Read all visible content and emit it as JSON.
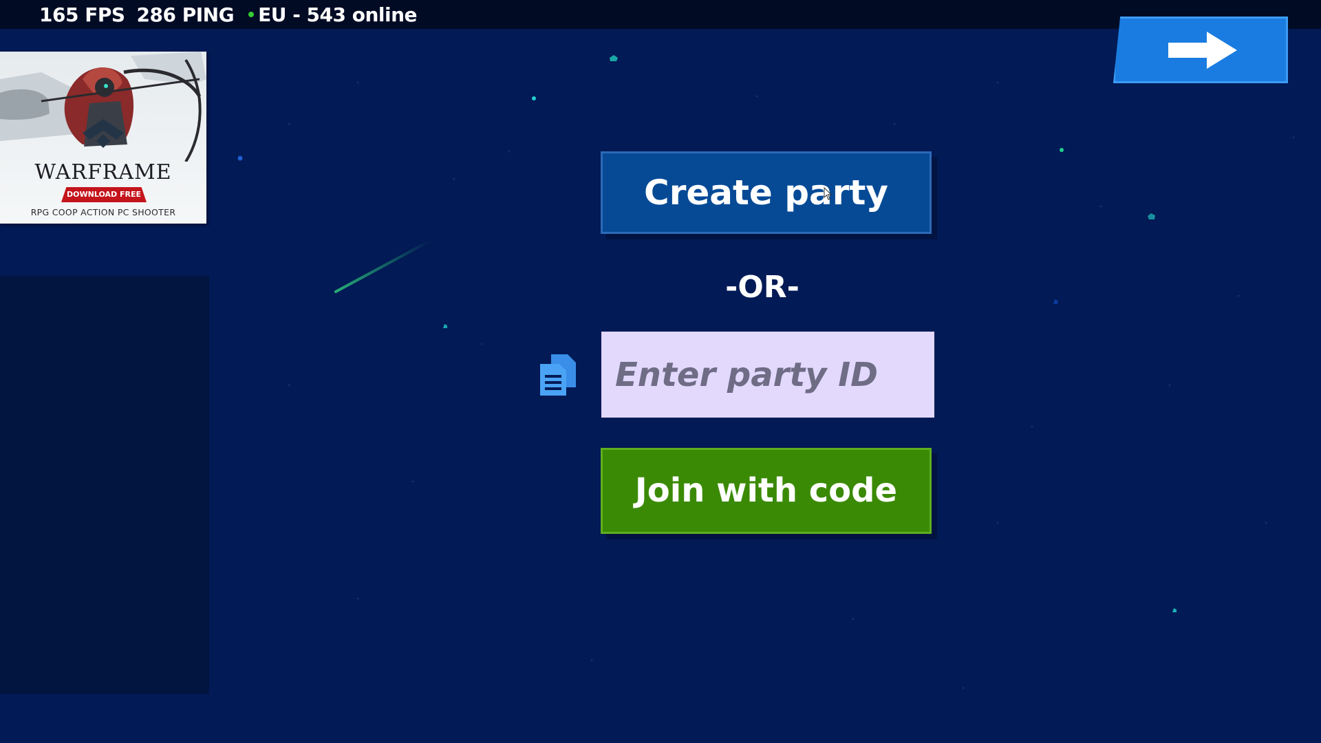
{
  "hud": {
    "fps": "165 FPS",
    "ping": "286 PING",
    "server": "EU - 543 online",
    "online_dot_color": "#33cc33"
  },
  "ad": {
    "brand": "WARFRAME",
    "cta": "DOWNLOAD FREE",
    "tagline": "RPG COOP ACTION PC SHOOTER"
  },
  "nav": {
    "next_icon": "arrow-right-icon"
  },
  "menu": {
    "create_party_label": "Create party",
    "or_label": "-OR-",
    "party_id_placeholder": "Enter party ID",
    "party_id_value": "",
    "paste_icon": "clipboard-icon",
    "join_label": "Join with code"
  },
  "colors": {
    "background": "#021a55",
    "create_button": "#064a96",
    "join_button": "#3b8a06",
    "input_background": "#e2d9fd",
    "next_button": "#1a7ce0"
  }
}
